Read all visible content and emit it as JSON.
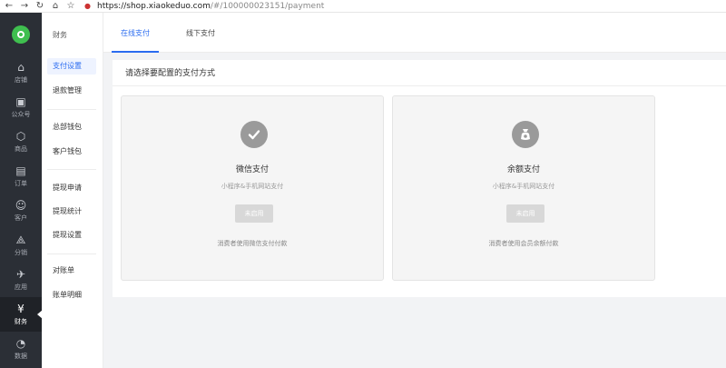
{
  "browser": {
    "url_host": "https://shop.xiaokeduo.com",
    "url_path": "/#/100000023151/payment"
  },
  "rail": {
    "items": [
      {
        "label": "店铺",
        "icon": "home-icon"
      },
      {
        "label": "公众号",
        "icon": "official-account-icon"
      },
      {
        "label": "商品",
        "icon": "product-box-icon"
      },
      {
        "label": "订单",
        "icon": "order-document-icon"
      },
      {
        "label": "客户",
        "icon": "customer-icon"
      },
      {
        "label": "分销",
        "icon": "distribution-icon"
      },
      {
        "label": "应用",
        "icon": "app-rocket-icon"
      },
      {
        "label": "财务",
        "icon": "finance-yen-icon"
      },
      {
        "label": "数据",
        "icon": "data-chart-icon"
      }
    ]
  },
  "subnav": {
    "title": "财务",
    "items": [
      "支付设置",
      "退款管理",
      "总部钱包",
      "客户钱包",
      "提现申请",
      "提现统计",
      "提现设置",
      "对账单",
      "账单明细"
    ]
  },
  "tabs": [
    "在线支付",
    "线下支付"
  ],
  "panel": {
    "heading": "请选择要配置的支付方式",
    "cards": [
      {
        "name": "微信支付",
        "desc": "小程序&手机网站支付",
        "button": "未启用",
        "note": "消费者使用微信支付付款",
        "icon": "wechat-check-icon"
      },
      {
        "name": "余额支付",
        "desc": "小程序&手机网站支付",
        "button": "未启用",
        "note": "消费者使用会员余额付款",
        "icon": "balance-bag-icon"
      }
    ]
  },
  "colors": {
    "accent": "#2b6cf0",
    "rail_bg": "#2b2f36",
    "logo_green": "#3fbf4f"
  }
}
